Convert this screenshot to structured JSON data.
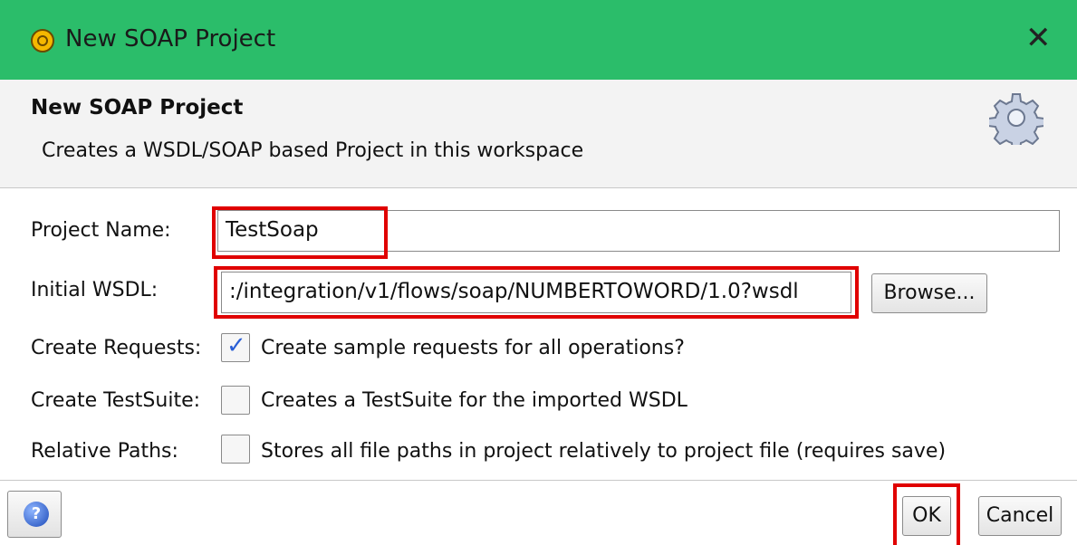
{
  "window": {
    "title": "New SOAP Project",
    "close_glyph": "✕"
  },
  "header": {
    "title": "New SOAP Project",
    "description": "Creates a WSDL/SOAP based Project in this workspace",
    "icon": "gear-icon"
  },
  "form": {
    "project_name_label": "Project Name:",
    "project_name_value": "TestSoap",
    "wsdl_label": "Initial WSDL:",
    "wsdl_value": ":/integration/v1/flows/soap/NUMBERTOWORD/1.0?wsdl",
    "browse_label": "Browse...",
    "create_requests_label": "Create Requests:",
    "create_requests_text": "Create sample requests for all operations?",
    "create_requests_checked": true,
    "create_testsuite_label": "Create TestSuite:",
    "create_testsuite_text": "Creates a TestSuite for the imported WSDL",
    "create_testsuite_checked": false,
    "relative_paths_label": "Relative Paths:",
    "relative_paths_text": "Stores all file paths in project relatively to project file (requires save)",
    "relative_paths_checked": false
  },
  "footer": {
    "help_glyph": "?",
    "ok_label": "OK",
    "cancel_label": "Cancel"
  },
  "colors": {
    "titlebar": "#2bbd6a",
    "highlight": "#e00000",
    "checkmark": "#2a5fd6"
  }
}
